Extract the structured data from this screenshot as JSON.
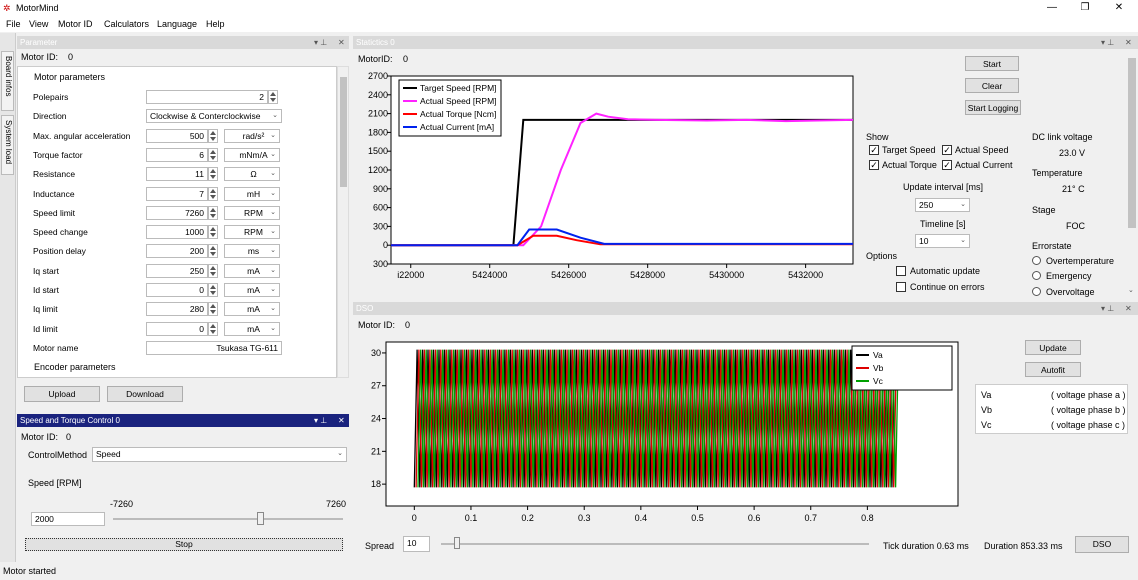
{
  "window": {
    "title": "MotorMind"
  },
  "menu": [
    "File",
    "View",
    "Motor ID",
    "Calculators",
    "Language",
    "Help"
  ],
  "side_tabs": [
    "Board infos",
    "System load"
  ],
  "parameter_panel": {
    "title": "Parameter",
    "motor_id_label": "Motor ID:",
    "motor_id": "0",
    "motor_group": "Motor parameters",
    "encoder_group": "Encoder parameters",
    "rows": [
      {
        "label": "Polepairs",
        "value": "2",
        "unit": ""
      },
      {
        "label": "Direction",
        "value": "Clockwise & Conterclockwise",
        "unit": ""
      },
      {
        "label": "Max. angular acceleration",
        "value": "500",
        "unit": "rad/s²"
      },
      {
        "label": "Torque factor",
        "value": "6",
        "unit": "mNm/A"
      },
      {
        "label": "Resistance",
        "value": "11",
        "unit": "Ω"
      },
      {
        "label": "Inductance",
        "value": "7",
        "unit": "mH"
      },
      {
        "label": "Speed limit",
        "value": "7260",
        "unit": "RPM"
      },
      {
        "label": "Speed change",
        "value": "1000",
        "unit": "RPM"
      },
      {
        "label": "Position delay",
        "value": "200",
        "unit": "ms"
      },
      {
        "label": "Iq start",
        "value": "250",
        "unit": "mA"
      },
      {
        "label": "Id start",
        "value": "0",
        "unit": "mA"
      },
      {
        "label": "Iq limit",
        "value": "280",
        "unit": "mA"
      },
      {
        "label": "Id limit",
        "value": "0",
        "unit": "mA"
      },
      {
        "label": "Motor name",
        "value": "Tsukasa TG-611",
        "unit": ""
      }
    ],
    "upload_label": "Upload",
    "download_label": "Download"
  },
  "speed_panel": {
    "title": "Speed and Torque Control 0",
    "motor_id_label": "Motor ID:",
    "motor_id": "0",
    "control_method_label": "ControlMethod",
    "control_method": "Speed",
    "speed_label": "Speed  [RPM]",
    "slider_min": "-7260",
    "slider_max": "7260",
    "speed_value": "2000",
    "slider_fraction": 0.638,
    "stop_label": "Stop"
  },
  "statistics_panel": {
    "title": "Statictics 0",
    "motor_id_label": "MotorID:",
    "motor_id": "0",
    "start_label": "Start",
    "clear_label": "Clear",
    "start_logging_label": "Start Logging",
    "show_label": "Show",
    "show_checks": [
      {
        "label": "Target Speed",
        "checked": true
      },
      {
        "label": "Actual Speed",
        "checked": true
      },
      {
        "label": "Actual Torque",
        "checked": true
      },
      {
        "label": "Actual Current",
        "checked": true
      }
    ],
    "update_interval_label": "Update interval [ms]",
    "update_interval": "250",
    "timeline_label": "Timeline [s]",
    "timeline": "10",
    "options_label": "Options",
    "options": [
      {
        "label": "Automatic update",
        "checked": false
      },
      {
        "label": "Continue on errors",
        "checked": false
      }
    ],
    "dc_link_label": "DC link voltage",
    "dc_link_value": "23.0 V",
    "temperature_label": "Temperature",
    "temperature_value": "21° C",
    "stage_label": "Stage",
    "stage_value": "FOC",
    "errorstate_label": "Errorstate",
    "errors": [
      "Overtemperature",
      "Emergency",
      "Overvoltage"
    ]
  },
  "dso_panel": {
    "title": "DSO",
    "motor_id_label": "Motor ID:",
    "motor_id": "0",
    "update_label": "Update",
    "autofit_label": "Autofit",
    "legend_table": [
      {
        "name": "Va",
        "desc": "( voltage phase a )"
      },
      {
        "name": "Vb",
        "desc": "( voltage phase b )"
      },
      {
        "name": "Vc",
        "desc": "( voltage phase c )"
      }
    ],
    "spread_label": "Spread",
    "spread_value": "10",
    "tick_duration": "Tick duration 0.63 ms",
    "duration": "Duration 853.33 ms",
    "dso_button": "DSO"
  },
  "status_bar": {
    "text": "Motor started"
  },
  "colors": {
    "target": "#000000",
    "speed": "#ff22ff",
    "torque": "#ff0000",
    "current": "#0022ee",
    "va": "#000000",
    "vb": "#dd0000",
    "vc": "#00a000",
    "active_header": "#1a237e"
  },
  "chart_data": [
    {
      "type": "line",
      "title": "",
      "xlabel": "",
      "ylabel": "",
      "xlim": [
        5421500,
        5433200
      ],
      "ylim": [
        -300,
        2700
      ],
      "x_ticks": [
        5422000,
        5424000,
        5426000,
        5428000,
        5430000,
        5432000
      ],
      "x_tick_labels": [
        "i22000",
        "5424000",
        "5426000",
        "5428000",
        "5430000",
        "5432000"
      ],
      "y_ticks": [
        -300,
        0,
        300,
        600,
        900,
        1200,
        1500,
        1800,
        2100,
        2400,
        2700
      ],
      "y_tick_labels": [
        "300",
        "0",
        "300",
        "600",
        "900",
        "1200",
        "1500",
        "1800",
        "2100",
        "2400",
        "2700"
      ],
      "legend_position": "top-left",
      "series": [
        {
          "name": "Target Speed [RPM]",
          "points": [
            [
              5421500,
              0
            ],
            [
              5424600,
              0
            ],
            [
              5424850,
              2000
            ],
            [
              5433200,
              2000
            ]
          ]
        },
        {
          "name": "Actual Speed [RPM]",
          "points": [
            [
              5421500,
              0
            ],
            [
              5424850,
              0
            ],
            [
              5425300,
              300
            ],
            [
              5425800,
              1200
            ],
            [
              5426300,
              1950
            ],
            [
              5426700,
              2100
            ],
            [
              5427000,
              2050
            ],
            [
              5427500,
              2010
            ],
            [
              5428200,
              2000
            ],
            [
              5429500,
              1990
            ],
            [
              5430500,
              2000
            ],
            [
              5431500,
              1980
            ],
            [
              5432300,
              1990
            ],
            [
              5433200,
              2000
            ]
          ]
        },
        {
          "name": "Actual Torque [Ncm]",
          "points": [
            [
              5421500,
              0
            ],
            [
              5424700,
              0
            ],
            [
              5425100,
              150
            ],
            [
              5425700,
              150
            ],
            [
              5426200,
              80
            ],
            [
              5426800,
              15
            ],
            [
              5433200,
              15
            ]
          ]
        },
        {
          "name": "Actual Current [mA]",
          "points": [
            [
              5421500,
              0
            ],
            [
              5424700,
              0
            ],
            [
              5425000,
              250
            ],
            [
              5425700,
              250
            ],
            [
              5426300,
              120
            ],
            [
              5426900,
              20
            ],
            [
              5433200,
              20
            ]
          ]
        }
      ]
    },
    {
      "type": "line",
      "title": "",
      "xlabel": "",
      "ylabel": "",
      "xlim": [
        -0.05,
        0.96
      ],
      "ylim": [
        16,
        31
      ],
      "x_ticks": [
        0,
        0.1,
        0.2,
        0.3,
        0.4,
        0.5,
        0.6,
        0.7,
        0.8
      ],
      "y_ticks": [
        18,
        21,
        24,
        27,
        30
      ],
      "legend_position": "top-right",
      "series": [
        {
          "name": "Va",
          "min": 17.7,
          "max": 30.3,
          "x_start": 0,
          "x_end": 0.853
        },
        {
          "name": "Vb",
          "min": 17.7,
          "max": 30.3,
          "x_start": 0,
          "x_end": 0.853
        },
        {
          "name": "Vc",
          "min": 17.7,
          "max": 30.3,
          "x_start": 0,
          "x_end": 0.853
        }
      ]
    }
  ]
}
